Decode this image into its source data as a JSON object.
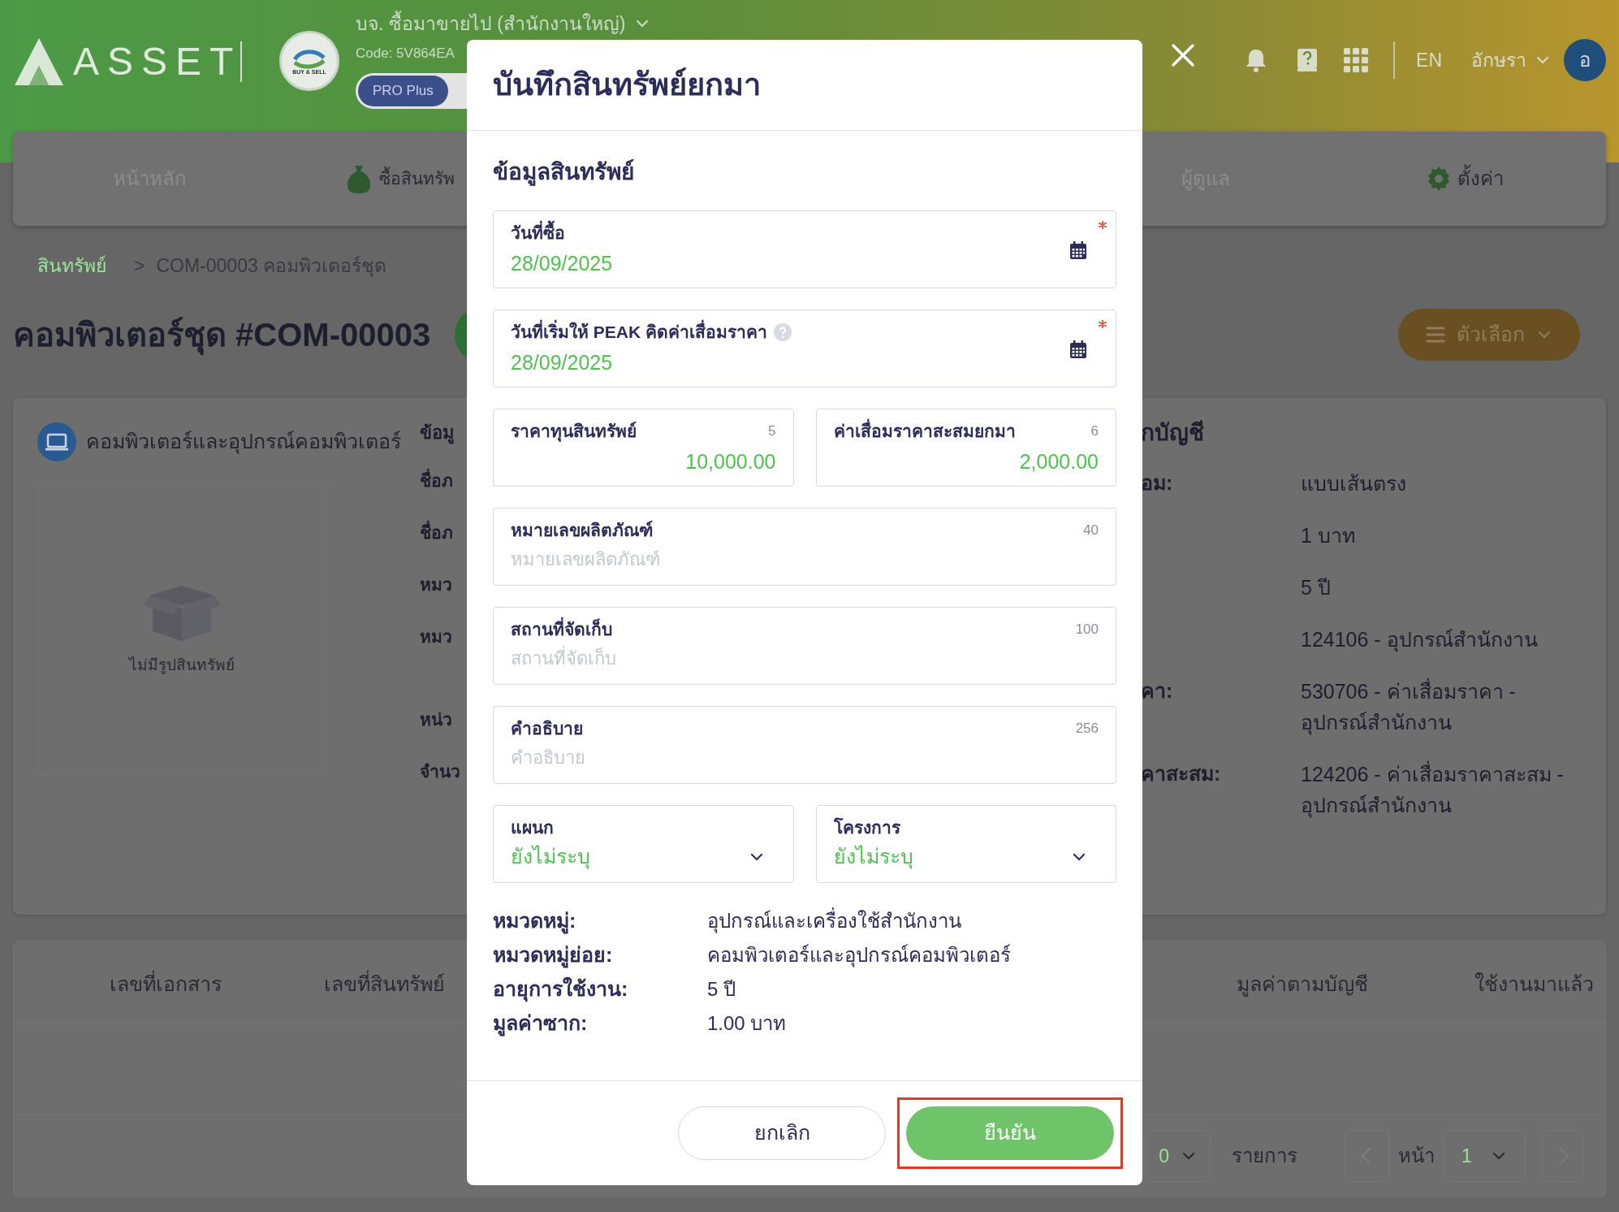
{
  "header": {
    "brand": "ASSET",
    "company_logo_text": "BUY & SELL",
    "company_name": "บจ. ซื้อมาขายไป (สำนักงานใหญ่)",
    "company_code": "Code: 5V864EA",
    "plan_badge": "PRO Plus",
    "language": "EN",
    "user_name": "อักษรา",
    "avatar_initial": "อ"
  },
  "nav": [
    {
      "label": "หน้าหลัก"
    },
    {
      "label": "ซื้อสินทรัพ"
    },
    {
      "label": "ผู้ดูแล"
    },
    {
      "label": "ตั้งค่า"
    }
  ],
  "breadcrumb": {
    "root": "สินทรัพย์",
    "separator": ">",
    "current": "COM-00003 คอมพิวเตอร์ชุด"
  },
  "page_title": "คอมพิวเตอร์ชุด #COM-00003",
  "options_button": "ตัวเลือก",
  "asset_card": {
    "category": "คอมพิวเตอร์และอุปกรณ์คอมพิวเตอร์",
    "no_image_text": "ไม่มีรูปสินทรัพย์",
    "info_heading": "ข้อมู",
    "info_labels": [
      "ชื่อภ",
      "ชื่อภ",
      "หมว",
      "หมว",
      "หน่ว",
      "จำนว"
    ],
    "accounting_heading": "กบัญชี",
    "accounting_rows": [
      {
        "label": "อม:",
        "value": "แบบเส้นตรง"
      },
      {
        "label": "",
        "value": "1 บาท"
      },
      {
        "label": "",
        "value": "5 ปี"
      },
      {
        "label": "",
        "value": "124106 - อุปกรณ์สำนักงาน"
      },
      {
        "label": "คา:",
        "value": "530706 - ค่าเสื่อมราคา - อุปกรณ์สำนักงาน"
      },
      {
        "label": "คาสะสม:",
        "value": "124206 - ค่าเสื่อมราคาสะสม - อุปกรณ์สำนักงาน"
      }
    ]
  },
  "table": {
    "columns": [
      "เลขที่เอกสาร",
      "เลขที่สินทรัพย์",
      "มูลค่าตามบัญชี",
      "ใช้งานมาแล้ว"
    ]
  },
  "pagination": {
    "page_size": "0",
    "page_size_label": "รายการ",
    "page_label": "หน้า",
    "page": "1"
  },
  "modal": {
    "title": "บันทึกสินทรัพย์ยกมา",
    "section": "ข้อมูลสินทรัพย์",
    "rows": [
      [
        {
          "kind": "date",
          "label": "วันที่ซื้อ",
          "value": "28/09/2025",
          "required": true,
          "help": false
        }
      ],
      [
        {
          "kind": "date",
          "label": "วันที่เริ่มให้ PEAK คิดค่าเสื่อมราคา",
          "value": "28/09/2025",
          "required": true,
          "help": true
        }
      ],
      [
        {
          "kind": "number",
          "label": "ราคาทุนสินทรัพย์",
          "counter": "5",
          "value": "10,000.00",
          "required": false,
          "help": false
        },
        {
          "kind": "number",
          "label": "ค่าเสื่อมราคาสะสมยกมา",
          "counter": "6",
          "value": "2,000.00",
          "required": false,
          "help": false
        }
      ],
      [
        {
          "kind": "text",
          "label": "หมายเลขผลิตภัณฑ์",
          "counter": "40",
          "placeholder": "หมายเลขผลิตภัณฑ์",
          "required": false,
          "help": false
        }
      ],
      [
        {
          "kind": "text",
          "label": "สถานที่จัดเก็บ",
          "counter": "100",
          "placeholder": "สถานที่จัดเก็บ",
          "required": false,
          "help": false
        }
      ],
      [
        {
          "kind": "text",
          "label": "คำอธิบาย",
          "counter": "256",
          "placeholder": "คำอธิบาย",
          "required": false,
          "help": false
        }
      ],
      [
        {
          "kind": "select",
          "label": "แผนก",
          "value": "ยังไม่ระบุ",
          "required": false,
          "help": false
        },
        {
          "kind": "select",
          "label": "โครงการ",
          "value": "ยังไม่ระบุ",
          "required": false,
          "help": false
        }
      ]
    ],
    "summary": [
      {
        "label": "หมวดหมู่:",
        "value": "อุปกรณ์และเครื่องใช้สำนักงาน"
      },
      {
        "label": "หมวดหมู่ย่อย:",
        "value": "คอมพิวเตอร์และอุปกรณ์คอมพิวเตอร์"
      },
      {
        "label": "อายุการใช้งาน:",
        "value": "5 ปี"
      },
      {
        "label": "มูลค่าซาก:",
        "value": "1.00 บาท"
      }
    ],
    "buttons": [
      {
        "kind": "secondary",
        "label": "ยกเลิก",
        "highlighted": false
      },
      {
        "kind": "primary",
        "label": "ยืนยัน",
        "highlighted": true
      }
    ]
  }
}
